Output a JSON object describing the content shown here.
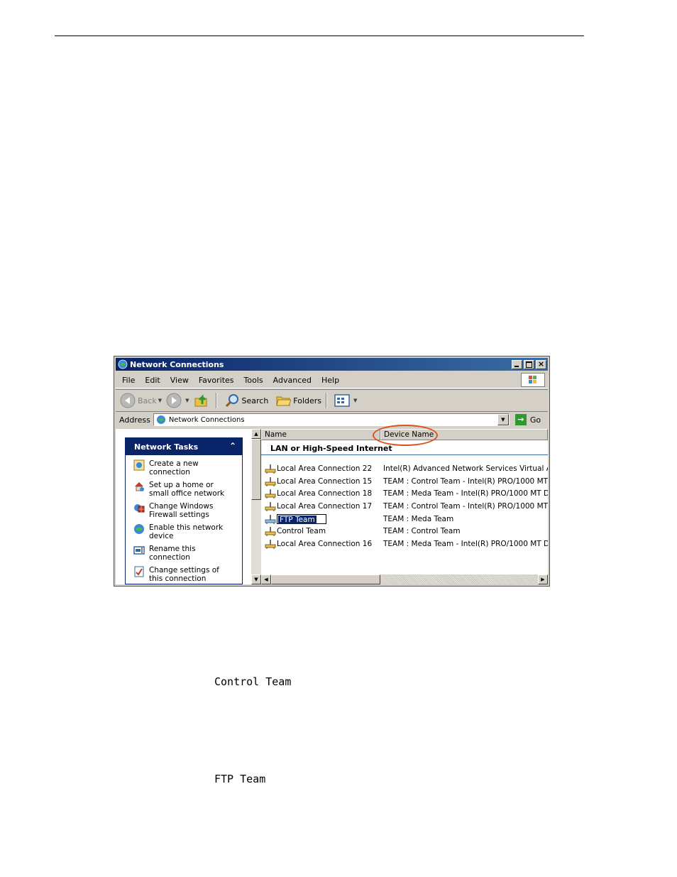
{
  "window": {
    "title": "Network Connections"
  },
  "menu": [
    "File",
    "Edit",
    "View",
    "Favorites",
    "Tools",
    "Advanced",
    "Help"
  ],
  "toolbar": {
    "back_label": "Back",
    "search_label": "Search",
    "folders_label": "Folders"
  },
  "address": {
    "label": "Address",
    "value": "Network Connections",
    "go_label": "Go"
  },
  "tasks": {
    "header": "Network Tasks",
    "items": [
      {
        "label": "Create a new connection",
        "icon": "new-connection-icon"
      },
      {
        "label": "Set up a home or small office network",
        "icon": "home-network-icon"
      },
      {
        "label": "Change Windows Firewall settings",
        "icon": "firewall-icon"
      },
      {
        "label": "Enable this network device",
        "icon": "globe-icon"
      },
      {
        "label": "Rename this connection",
        "icon": "rename-icon"
      },
      {
        "label": "Change settings of this connection",
        "icon": "settings-icon"
      }
    ]
  },
  "list": {
    "columns": {
      "name": "Name",
      "device": "Device Name"
    },
    "group_title": "LAN or High-Speed Internet",
    "rows": [
      {
        "name": "Local Area Connection 22",
        "device": "Intel(R) Advanced Network Services Virtual A..."
      },
      {
        "name": "Local Area Connection 15",
        "device": "TEAM : Control Team - Intel(R) PRO/1000 MT ..."
      },
      {
        "name": "Local Area Connection 18",
        "device": "TEAM : Meda Team - Intel(R) PRO/1000 MT D..."
      },
      {
        "name": "Local Area Connection 17",
        "device": "TEAM : Control Team - Intel(R) PRO/1000 MT ..."
      },
      {
        "name": "FTP Team",
        "device": "TEAM : Meda Team",
        "editing": true
      },
      {
        "name": "Control Team",
        "device": "TEAM : Control Team"
      },
      {
        "name": "Local Area Connection 16",
        "device": "TEAM : Meda Team - Intel(R) PRO/1000 MT D..."
      }
    ]
  },
  "doc_text": {
    "line1": "Control Team",
    "line2": "FTP Team"
  },
  "colors": {
    "titlebar": "#0a246a",
    "highlight_ellipse": "#d9531e"
  }
}
